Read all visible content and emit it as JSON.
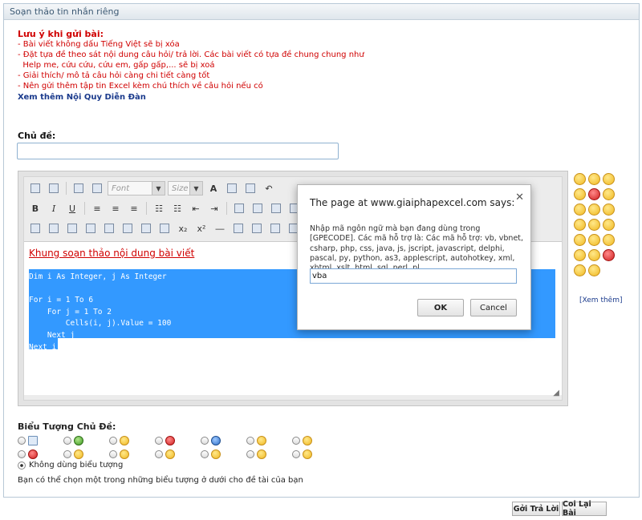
{
  "panel": {
    "title": "Soạn thảo tin nhắn riêng"
  },
  "notes": {
    "heading": "Lưu ý khi gửi bài:",
    "lines": [
      "- Bài viết không dấu Tiếng Việt sẽ bị xóa",
      "- Đặt tựa đề theo sát nội dung câu hỏi/ trả lời. Các bài viết có tựa đề chung chung như",
      "  Help me, cứu cứu, cứu em, gấp gấp,... sẽ bị xoá",
      "- Giải thích/ mô tả câu hỏi càng chi tiết càng tốt",
      "- Nên gửi thêm tập tin Excel kèm chú thích về câu hỏi nếu có"
    ],
    "rules_link": "Xem thêm Nội Quy Diễn Đàn"
  },
  "subject": {
    "label": "Chủ đề:",
    "value": ""
  },
  "toolbar": {
    "font_placeholder": "Font",
    "size_placeholder": "Size"
  },
  "editor": {
    "title": "Khung soạn thảo nội dung bài viết",
    "code": "Dim i As Integer, j As Integer\n\nFor i = 1 To 6\n    For j = 1 To 2\n        Cells(i, j).Value = 100\n    Next j\nNext i"
  },
  "smilies": {
    "more_link": "[Xem thêm]"
  },
  "dialog": {
    "title": "The page at www.giaiphapexcel.com says:",
    "message": "Nhập mã ngôn ngữ mà bạn đang dùng trong [GPECODE]. Các mã hỗ trợ là: Các mã hỗ trợ: vb, vbnet, csharp, php, css, java, js, jscript, javascript, delphi, pascal, py, python, as3, applescript, autohotkey, xml, xhtml, xslt, html, sql, perl, pl",
    "input_value": "vba",
    "ok_label": "OK",
    "cancel_label": "Cancel"
  },
  "post_icons": {
    "title": "Biểu Tượng Chủ Đề:",
    "none_label": "Không dùng biểu tượng",
    "hint": "Bạn có thể chọn một trong những biểu tượng ở dưới cho đề tài của bạn"
  },
  "buttons": {
    "submit": "Gởi Trả Lời",
    "preview": "Coi Lại Bài"
  }
}
